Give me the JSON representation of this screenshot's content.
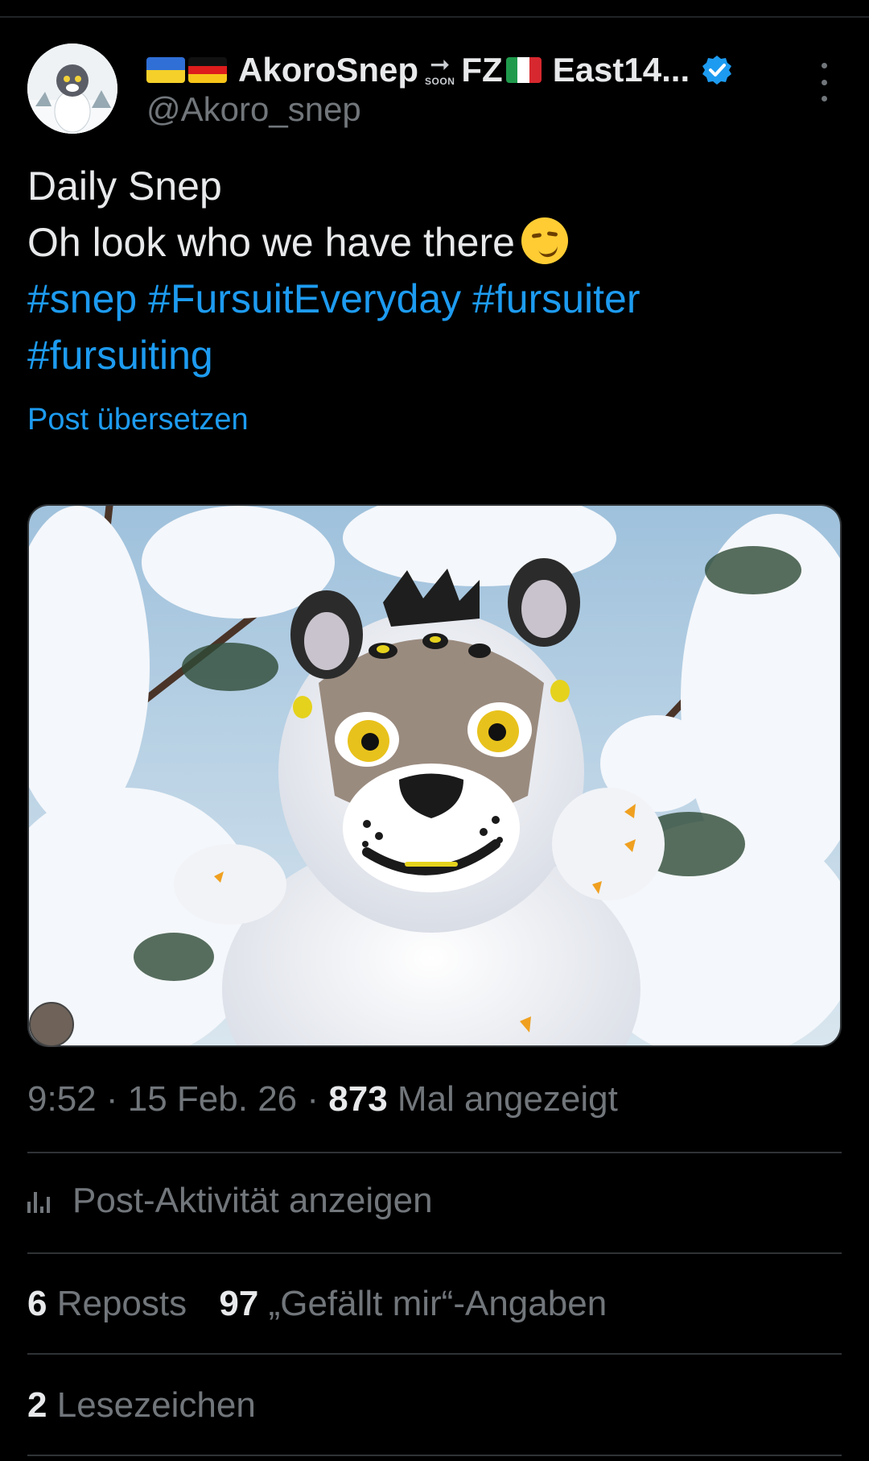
{
  "author": {
    "display_name": "AkoroSnep",
    "name_suffix_team": "FZ",
    "name_suffix_rest": "East14...",
    "soon_label": "SOON",
    "handle": "@Akoro_snep",
    "icons": [
      "ukraine-flag",
      "germany-flag",
      "arrow-right-icon",
      "italy-flag",
      "verified-badge-icon",
      "more-icon"
    ]
  },
  "post": {
    "line1": "Daily Snep",
    "line2": "Oh look who we have there",
    "emoji": "smirking-face",
    "hashtags": [
      "#snep",
      "#FursuitEveryday",
      "#fursuiter",
      "#fursuiting"
    ],
    "translate_label": "Post übersetzen"
  },
  "meta": {
    "time": "9:52",
    "date": "15 Feb. 26",
    "views": "873",
    "views_label": "Mal angezeigt"
  },
  "activity_label": "Post-Aktivität anzeigen",
  "stats": {
    "reposts": "6",
    "reposts_label": "Reposts",
    "likes": "97",
    "likes_label": "„Gefällt mir“-Angaben",
    "bookmarks": "2",
    "bookmarks_label": "Lesezeichen"
  },
  "colors": {
    "background": "#000000",
    "text": "#e7e9ea",
    "muted": "#71767b",
    "link": "#1d9bf0",
    "divider": "#2f3336"
  }
}
